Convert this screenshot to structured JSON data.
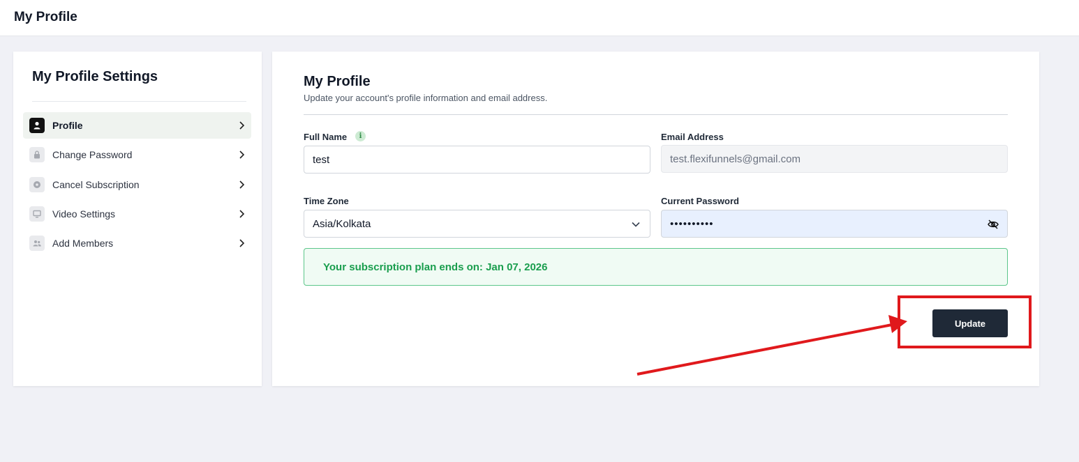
{
  "header": {
    "title": "My Profile"
  },
  "sidebar": {
    "title": "My Profile Settings",
    "items": [
      {
        "label": "Profile",
        "icon": "user-icon",
        "active": true
      },
      {
        "label": "Change Password",
        "icon": "lock-icon",
        "active": false
      },
      {
        "label": "Cancel Subscription",
        "icon": "cancel-circle-icon",
        "active": false
      },
      {
        "label": "Video Settings",
        "icon": "monitor-icon",
        "active": false
      },
      {
        "label": "Add Members",
        "icon": "users-icon",
        "active": false
      }
    ]
  },
  "main": {
    "title": "My Profile",
    "subtitle": "Update your account's profile information and email address.",
    "full_name": {
      "label": "Full Name",
      "value": "test",
      "info_icon": "info-icon"
    },
    "email": {
      "label": "Email Address",
      "placeholder": "test.flexifunnels@gmail.com"
    },
    "timezone": {
      "label": "Time Zone",
      "value": "Asia/Kolkata"
    },
    "password": {
      "label": "Current Password",
      "value": "••••••••••",
      "toggle_icon": "eye-off-icon"
    },
    "subscription_notice": "Your subscription plan ends on: Jan 07, 2026",
    "update_label": "Update"
  },
  "colors": {
    "page_bg": "#f0f1f6",
    "button_bg": "#1f2937",
    "success_text": "#1a9e4e",
    "success_border": "#5cc68a",
    "annotation_red": "#e0191c"
  }
}
